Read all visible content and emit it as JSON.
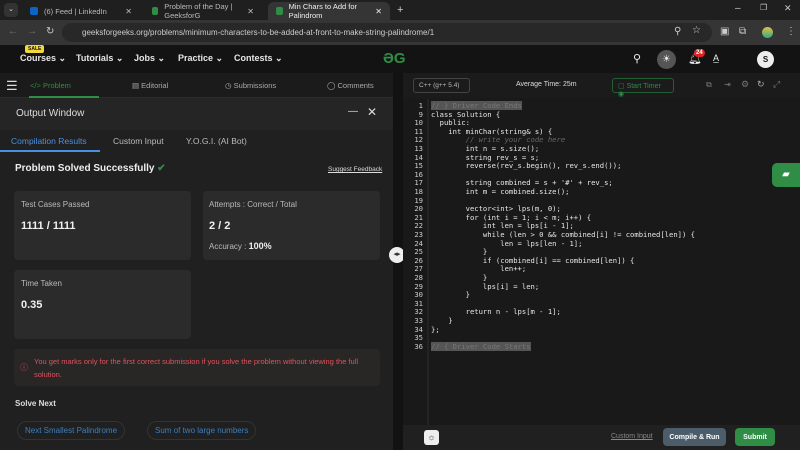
{
  "browser": {
    "tabs": [
      {
        "label": "(6) Feed | LinkedIn",
        "color": "#0a66c2"
      },
      {
        "label": "Problem of the Day | GeeksforG",
        "color": "#2f8d46"
      },
      {
        "label": "Min Chars to Add for Palindrom",
        "color": "#2f8d46"
      }
    ],
    "new_tab": "+",
    "url": "geeksforgeeks.org/problems/minimum-characters-to-be-added-at-front-to-make-string-palindrome/1"
  },
  "header": {
    "sale": "SALE",
    "nav": [
      "Courses",
      "Tutorials",
      "Jobs",
      "Practice",
      "Contests"
    ],
    "notif_count": "24",
    "avatar": "S"
  },
  "subnav": {
    "problem": "Problem",
    "editorial": "Editorial",
    "submissions": "Submissions",
    "comments": "Comments"
  },
  "output": {
    "title": "Output Window",
    "tabs": [
      "Compilation Results",
      "Custom Input",
      "Y.O.G.I. (AI Bot)"
    ],
    "status": "Problem Solved Successfully",
    "feedback": "Suggest Feedback",
    "tc_label": "Test Cases Passed",
    "tc_value": "1111 / 1111",
    "att_label": "Attempts : Correct / Total",
    "att_value": "2 / 2",
    "acc_label": "Accuracy :",
    "acc_value": "100%",
    "time_label": "Time Taken",
    "time_value": "0.35",
    "warning": "You get marks only for the first correct submission if you solve the problem without viewing the full solution.",
    "solve_next": "Solve Next",
    "next": [
      "Next Smallest Palindrome",
      "Sum of two large numbers"
    ]
  },
  "editor": {
    "language": "C++ (g++ 5.4)",
    "avg_time": "Average Time: 25m",
    "timer": "Start Timer",
    "lines": [
      {
        "n": "1",
        "t": "// } Driver Code Ends",
        "k": "dr"
      },
      {
        "n": "9",
        "t": "class Solution {",
        "k": ""
      },
      {
        "n": "10",
        "t": "  public:",
        "k": ""
      },
      {
        "n": "11",
        "t": "    int minChar(string& s) {",
        "k": ""
      },
      {
        "n": "12",
        "t": "        // write your code here",
        "k": "cm"
      },
      {
        "n": "13",
        "t": "        int n = s.size();",
        "k": ""
      },
      {
        "n": "14",
        "t": "        string rev_s = s;",
        "k": ""
      },
      {
        "n": "15",
        "t": "        reverse(rev_s.begin(), rev_s.end());",
        "k": ""
      },
      {
        "n": "16",
        "t": "",
        "k": ""
      },
      {
        "n": "17",
        "t": "        string combined = s + '#' + rev_s;",
        "k": ""
      },
      {
        "n": "18",
        "t": "        int m = combined.size();",
        "k": ""
      },
      {
        "n": "19",
        "t": "",
        "k": ""
      },
      {
        "n": "20",
        "t": "        vector<int> lps(m, 0);",
        "k": ""
      },
      {
        "n": "21",
        "t": "        for (int i = 1; i < m; i++) {",
        "k": ""
      },
      {
        "n": "22",
        "t": "            int len = lps[i - 1];",
        "k": ""
      },
      {
        "n": "23",
        "t": "            while (len > 0 && combined[i] != combined[len]) {",
        "k": ""
      },
      {
        "n": "24",
        "t": "                len = lps[len - 1];",
        "k": ""
      },
      {
        "n": "25",
        "t": "            }",
        "k": ""
      },
      {
        "n": "26",
        "t": "            if (combined[i] == combined[len]) {",
        "k": ""
      },
      {
        "n": "27",
        "t": "                len++;",
        "k": ""
      },
      {
        "n": "28",
        "t": "            }",
        "k": ""
      },
      {
        "n": "29",
        "t": "            lps[i] = len;",
        "k": ""
      },
      {
        "n": "30",
        "t": "        }",
        "k": ""
      },
      {
        "n": "31",
        "t": "",
        "k": ""
      },
      {
        "n": "32",
        "t": "        return n - lps[m - 1];",
        "k": ""
      },
      {
        "n": "33",
        "t": "    }",
        "k": ""
      },
      {
        "n": "34",
        "t": "};",
        "k": ""
      },
      {
        "n": "35",
        "t": "",
        "k": ""
      },
      {
        "n": "36",
        "t": "// { Driver Code Starts",
        "k": "dr"
      }
    ],
    "custom_input": "Custom Input",
    "compile": "Compile & Run",
    "submit": "Submit"
  },
  "colors": {
    "green": "#2f8d46",
    "warn": "#e0525d",
    "link": "#3c7fc0"
  }
}
